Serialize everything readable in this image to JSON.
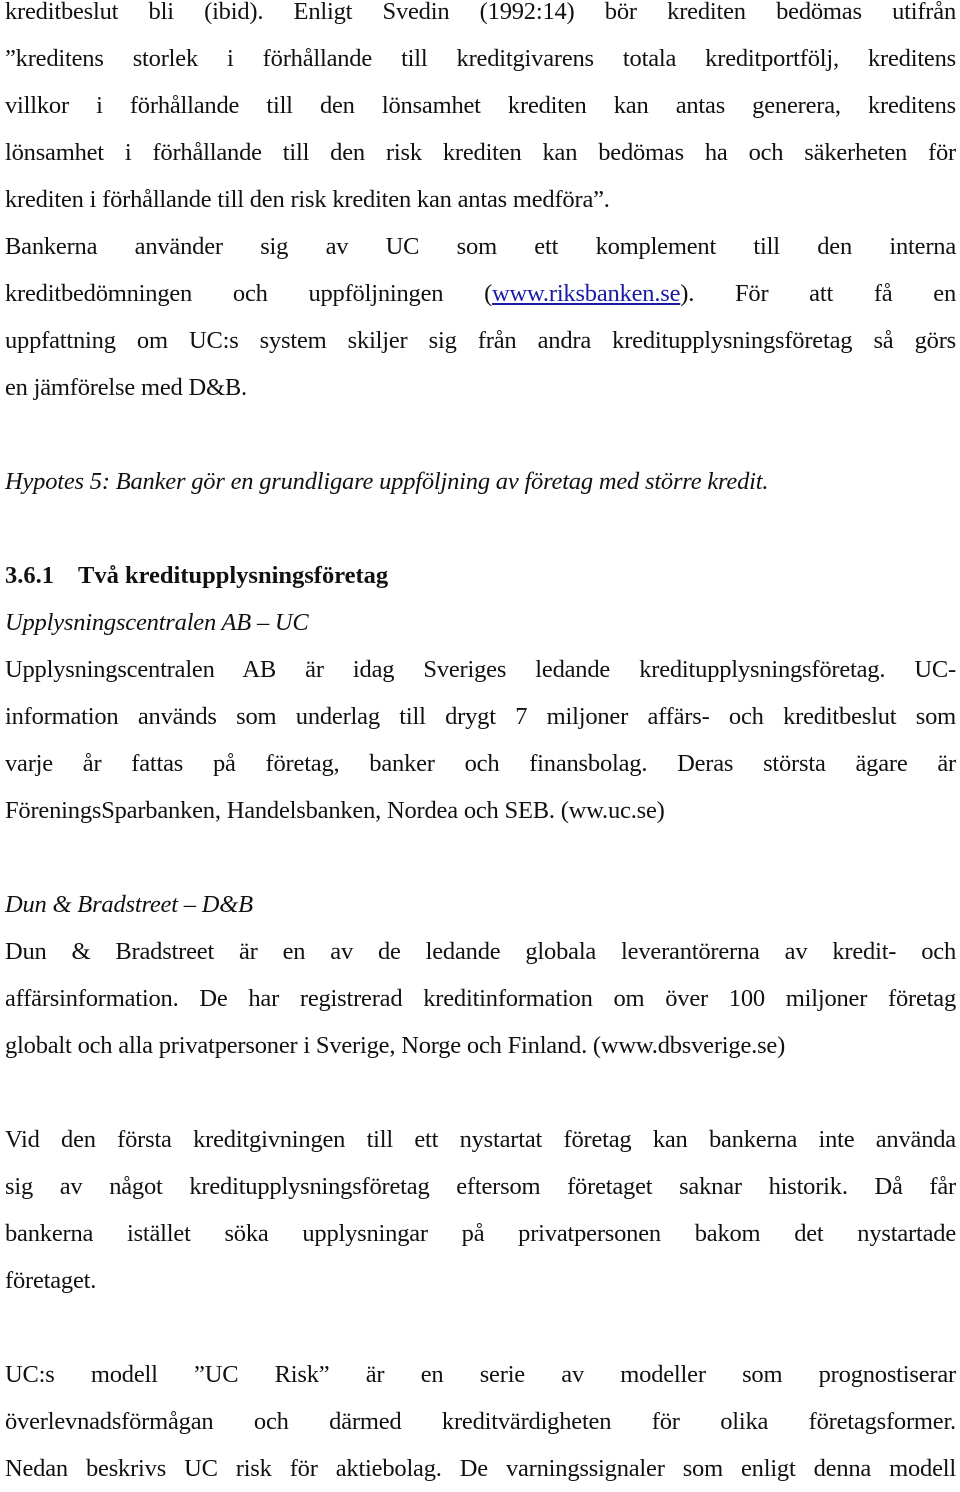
{
  "document": {
    "intro_paragraph": {
      "lines": [
        "kreditbeslut bli (ibid). Enligt Svedin (1992:14) bör krediten bedömas utifrån",
        "”kreditens storlek i förhållande till kreditgivarens totala kreditportfölj, kreditens",
        "villkor i förhållande till den lönsamhet krediten kan antas generera, kreditens",
        "lönsamhet i förhållande till den risk krediten kan bedömas ha och säkerheten för",
        "krediten i förhållande till den risk krediten kan antas medföra”."
      ]
    },
    "uc_paragraph": {
      "line1": "Bankerna använder sig av UC som ett komplement till den interna",
      "line2_before": "kreditbedömningen och uppföljningen (",
      "line2_link": "www.riksbanken.se",
      "line2_after": "). För att få en",
      "line3": "uppfattning om UC:s system skiljer sig från andra kreditupplysningsföretag så görs",
      "line4": "en jämförelse med D&B."
    },
    "hypothesis": "Hypotes 5: Banker gör en grundligare uppföljning av företag med större kredit.",
    "section": {
      "number": "3.6.1",
      "title": "Två kreditupplysningsföretag"
    },
    "uc_subheading": "Upplysningscentralen AB – UC",
    "uc_description": {
      "lines": [
        "Upplysningscentralen AB är idag Sveriges ledande kreditupplysningsföretag. UC-",
        "information används som underlag till drygt 7 miljoner affärs- och kreditbeslut som",
        "varje år fattas på företag, banker och finansbolag. Deras största ägare är",
        "FöreningsSparbanken, Handelsbanken, Nordea och SEB. (ww.uc.se)"
      ]
    },
    "db_subheading": "Dun & Bradstreet – D&B",
    "db_description": {
      "lines": [
        "Dun & Bradstreet är en av de ledande globala leverantörerna av kredit- och",
        "affärsinformation. De har registrerad kreditinformation om över 100 miljoner företag",
        "globalt och alla privatpersoner i Sverige, Norge och Finland. (www.dbsverige.se)"
      ]
    },
    "startup_paragraph": {
      "lines": [
        "Vid den första kreditgivningen till ett nystartat företag kan bankerna inte använda",
        "sig av något kreditupplysningsföretag eftersom företaget saknar historik. Då får",
        "bankerna istället söka upplysningar på privatpersonen bakom det nystartade",
        "företaget."
      ]
    },
    "ucrisk_paragraph": {
      "lines": [
        "UC:s modell ”UC Risk” är en serie av modeller som prognostiserar",
        "överlevnadsförmågan och därmed kreditvärdigheten för olika företagsformer.",
        "Nedan beskrivs UC risk för aktiebolag. De varningssignaler som enligt denna modell"
      ]
    }
  },
  "colors": {
    "text": "#111111",
    "link": "#1a1aa6",
    "background": "#ffffff"
  }
}
